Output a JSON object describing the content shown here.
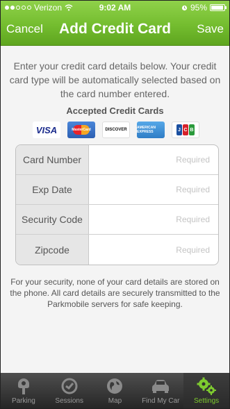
{
  "status_bar": {
    "carrier": "Verizon",
    "time": "9:02 AM",
    "battery": "95%",
    "battery_level": 0.95
  },
  "nav": {
    "cancel_label": "Cancel",
    "title": "Add Credit Card",
    "save_label": "Save"
  },
  "intro_text": "Enter your credit card details below. Your credit card type will be automatically selected based on the card number entered.",
  "accepted_cards": {
    "title": "Accepted Credit Cards",
    "cards": [
      {
        "name": "visa-card-icon",
        "text": "VISA"
      },
      {
        "name": "mastercard-card-icon",
        "text": "MasterCard"
      },
      {
        "name": "discover-card-icon",
        "text": "DISCOVER"
      },
      {
        "name": "amex-card-icon",
        "text": "AMERICAN EXPRESS"
      },
      {
        "name": "jcb-card-icon",
        "text": "JCB"
      }
    ]
  },
  "form": {
    "rows": [
      {
        "label": "Card Number",
        "placeholder": "Required",
        "value": ""
      },
      {
        "label": "Exp Date",
        "placeholder": "Required",
        "value": ""
      },
      {
        "label": "Security Code",
        "placeholder": "Required",
        "value": ""
      },
      {
        "label": "Zipcode",
        "placeholder": "Required",
        "value": ""
      }
    ]
  },
  "security_note": "For your security, none of your card details are stored on the phone. All card details are securely transmitted to the Parkmobile servers for safe keeping.",
  "tabs": [
    {
      "label": "Parking",
      "icon": "parking-meter-icon",
      "active": false
    },
    {
      "label": "Sessions",
      "icon": "clock-check-icon",
      "active": false
    },
    {
      "label": "Map",
      "icon": "globe-icon",
      "active": false
    },
    {
      "label": "Find My Car",
      "icon": "car-icon",
      "active": false
    },
    {
      "label": "Settings",
      "icon": "gears-icon",
      "active": true
    }
  ],
  "colors": {
    "accent_green": "#74bd2f",
    "active_tab": "#7ecb2f"
  }
}
